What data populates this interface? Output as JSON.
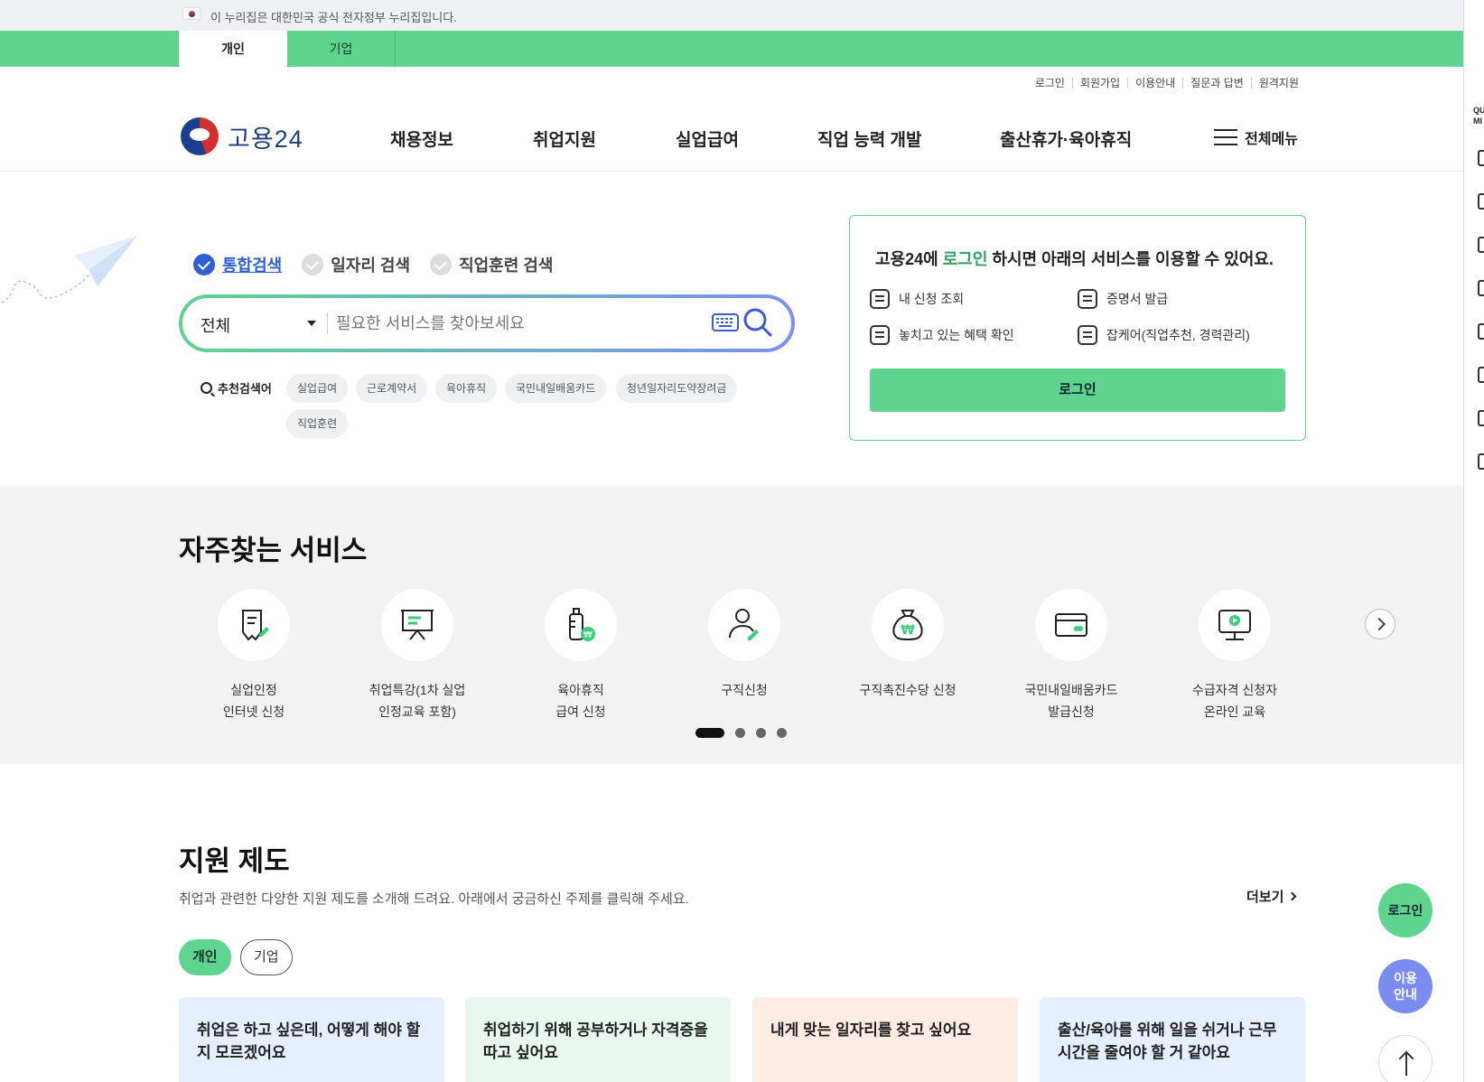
{
  "gov_banner": {
    "text": "이 누리집은 대한민국 공식 전자정부 누리집입니다."
  },
  "user_type_tabs": [
    {
      "label": "개인",
      "active": true
    },
    {
      "label": "기업",
      "active": false
    }
  ],
  "util_links": [
    "로그인",
    "회원가입",
    "이용안내",
    "질문과 답변",
    "원격지원"
  ],
  "header": {
    "logo_text": "고용24",
    "nav": [
      "채용정보",
      "취업지원",
      "실업급여",
      "직업 능력 개발",
      "출산휴가·육아휴직"
    ],
    "all_menu_label": "전체메뉴"
  },
  "search": {
    "tabs": [
      {
        "label": "통합검색",
        "active": true
      },
      {
        "label": "일자리 검색",
        "active": false
      },
      {
        "label": "직업훈련 검색",
        "active": false
      }
    ],
    "category_selected": "전체",
    "placeholder": "필요한 서비스를 찾아보세요",
    "recommend_label": "추천검색어",
    "recommend_chips": [
      "실업급여",
      "근로계약서",
      "육아휴직",
      "국민내일배움카드",
      "청년일자리도약장려금",
      "직업훈련"
    ]
  },
  "login_card": {
    "title_prefix": "고용24에 ",
    "title_highlight": "로그인",
    "title_suffix": " 하시면 아래의 서비스를 이용할 수 있어요.",
    "items": [
      "내 신청 조회",
      "증명서 발급",
      "놓치고 있는 혜택 확인",
      "잡케어(직업추천, 경력관리)"
    ],
    "button_label": "로그인"
  },
  "frequent": {
    "title": "자주찾는 서비스",
    "services": [
      {
        "label": "실업인정\n인터넷 신청",
        "icon": "document-pen-icon"
      },
      {
        "label": "취업특강(1차 실업\n인정교육 포함)",
        "icon": "presentation-board-icon"
      },
      {
        "label": "육아휴직\n급여 신청",
        "icon": "baby-bottle-won-icon"
      },
      {
        "label": "구직신청",
        "icon": "person-pen-icon"
      },
      {
        "label": "구직촉진수당 신청",
        "icon": "money-bag-won-icon"
      },
      {
        "label": "국민내일배움카드\n발급신청",
        "icon": "card-icon"
      },
      {
        "label": "수급자격 신청자\n온라인 교육",
        "icon": "monitor-play-icon"
      }
    ],
    "pagination": {
      "pages": 4,
      "current": 1
    }
  },
  "support": {
    "title": "지원 제도",
    "description": "취업과 관련한 다양한 지원 제도를 소개해 드려요. 아래에서 궁금하신 주제를 클릭해 주세요.",
    "more_label": "더보기",
    "tabs": [
      {
        "label": "개인",
        "active": true
      },
      {
        "label": "기업",
        "active": false
      }
    ],
    "cards": [
      {
        "text": "취업은 하고 싶은데, 어떻게 해야 할지 모르겠어요",
        "color": "#e6efff"
      },
      {
        "text": "취업하기 위해 공부하거나 자격증을 따고 싶어요",
        "color": "#e8f8ee"
      },
      {
        "text": "내게 맞는 일자리를 찾고 싶어요",
        "color": "#fdece4"
      },
      {
        "text": "출산/육아를 위해 일을 쉬거나 근무시간을 줄여야 할 거 같아요",
        "color": "#e6efff"
      }
    ]
  },
  "floating": {
    "login_label": "로그인",
    "guide_label": "이용안내"
  },
  "quick_menu": {
    "label": "QU MI"
  },
  "colors": {
    "brand_green": "#5ed48f",
    "accent_blue": "#2f5fd6",
    "guide_purple": "#7b8cf0"
  }
}
